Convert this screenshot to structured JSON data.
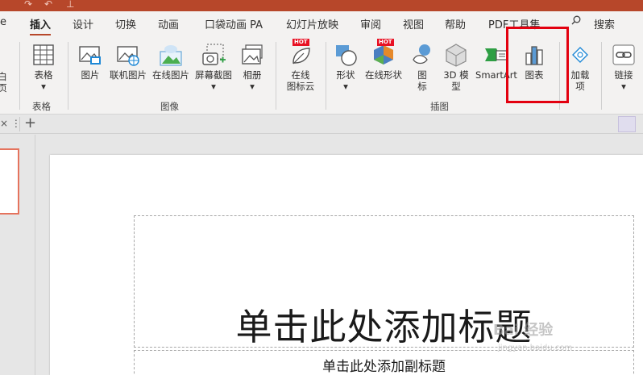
{
  "tabs": [
    {
      "label": "e"
    },
    {
      "label": "插入"
    },
    {
      "label": "设计"
    },
    {
      "label": "切换"
    },
    {
      "label": "动画"
    },
    {
      "label": "口袋动画 PA"
    },
    {
      "label": "幻灯片放映"
    },
    {
      "label": "审阅"
    },
    {
      "label": "视图"
    },
    {
      "label": "帮助"
    },
    {
      "label": "PDF工具集"
    },
    {
      "label": "搜索"
    }
  ],
  "ribbon": {
    "left_partial": {
      "line1": "白",
      "line2": "页"
    },
    "table": {
      "label": "表格",
      "group": "表格"
    },
    "images": {
      "picture": "图片",
      "online_picture": "联机图片",
      "online_image": "在线图片",
      "screenshot": "屏幕截图",
      "album": "相册",
      "group": "图像"
    },
    "icon_cloud": {
      "line1": "在线",
      "line2": "图标云",
      "hot": "HOT"
    },
    "illustrations": {
      "shapes": "形状",
      "online_shapes": "在线形状",
      "online_shapes_hot": "HOT",
      "icons_line1": "图",
      "icons_line2": "标",
      "model_line1": "3D 模",
      "model_line2": "型",
      "smartart": "SmartArt",
      "chart": "图表",
      "group": "插图"
    },
    "addins": {
      "line1": "加载",
      "line2": "项"
    },
    "link": {
      "label": "链接"
    }
  },
  "slide": {
    "title_placeholder": "单击此处添加标题",
    "subtitle_placeholder": "单击此处添加副标题"
  },
  "watermark": {
    "line1": "Bai 经验",
    "line2": "jingyan.baidu.com"
  },
  "colors": {
    "accent": "#b7472a",
    "highlight": "#e3000f"
  }
}
